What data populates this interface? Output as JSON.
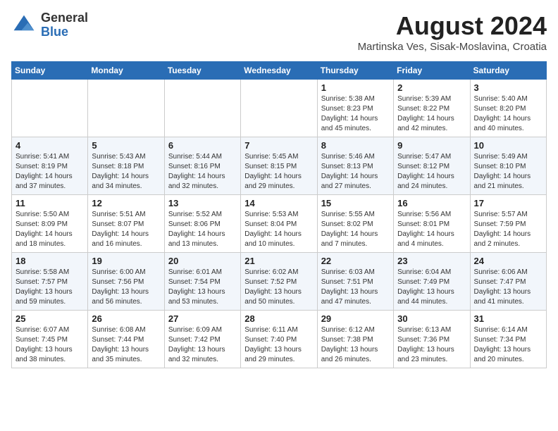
{
  "header": {
    "logo_line1": "General",
    "logo_line2": "Blue",
    "month_year": "August 2024",
    "location": "Martinska Ves, Sisak-Moslavina, Croatia"
  },
  "days_of_week": [
    "Sunday",
    "Monday",
    "Tuesday",
    "Wednesday",
    "Thursday",
    "Friday",
    "Saturday"
  ],
  "weeks": [
    [
      {
        "day": "",
        "info": ""
      },
      {
        "day": "",
        "info": ""
      },
      {
        "day": "",
        "info": ""
      },
      {
        "day": "",
        "info": ""
      },
      {
        "day": "1",
        "info": "Sunrise: 5:38 AM\nSunset: 8:23 PM\nDaylight: 14 hours\nand 45 minutes."
      },
      {
        "day": "2",
        "info": "Sunrise: 5:39 AM\nSunset: 8:22 PM\nDaylight: 14 hours\nand 42 minutes."
      },
      {
        "day": "3",
        "info": "Sunrise: 5:40 AM\nSunset: 8:20 PM\nDaylight: 14 hours\nand 40 minutes."
      }
    ],
    [
      {
        "day": "4",
        "info": "Sunrise: 5:41 AM\nSunset: 8:19 PM\nDaylight: 14 hours\nand 37 minutes."
      },
      {
        "day": "5",
        "info": "Sunrise: 5:43 AM\nSunset: 8:18 PM\nDaylight: 14 hours\nand 34 minutes."
      },
      {
        "day": "6",
        "info": "Sunrise: 5:44 AM\nSunset: 8:16 PM\nDaylight: 14 hours\nand 32 minutes."
      },
      {
        "day": "7",
        "info": "Sunrise: 5:45 AM\nSunset: 8:15 PM\nDaylight: 14 hours\nand 29 minutes."
      },
      {
        "day": "8",
        "info": "Sunrise: 5:46 AM\nSunset: 8:13 PM\nDaylight: 14 hours\nand 27 minutes."
      },
      {
        "day": "9",
        "info": "Sunrise: 5:47 AM\nSunset: 8:12 PM\nDaylight: 14 hours\nand 24 minutes."
      },
      {
        "day": "10",
        "info": "Sunrise: 5:49 AM\nSunset: 8:10 PM\nDaylight: 14 hours\nand 21 minutes."
      }
    ],
    [
      {
        "day": "11",
        "info": "Sunrise: 5:50 AM\nSunset: 8:09 PM\nDaylight: 14 hours\nand 18 minutes."
      },
      {
        "day": "12",
        "info": "Sunrise: 5:51 AM\nSunset: 8:07 PM\nDaylight: 14 hours\nand 16 minutes."
      },
      {
        "day": "13",
        "info": "Sunrise: 5:52 AM\nSunset: 8:06 PM\nDaylight: 14 hours\nand 13 minutes."
      },
      {
        "day": "14",
        "info": "Sunrise: 5:53 AM\nSunset: 8:04 PM\nDaylight: 14 hours\nand 10 minutes."
      },
      {
        "day": "15",
        "info": "Sunrise: 5:55 AM\nSunset: 8:02 PM\nDaylight: 14 hours\nand 7 minutes."
      },
      {
        "day": "16",
        "info": "Sunrise: 5:56 AM\nSunset: 8:01 PM\nDaylight: 14 hours\nand 4 minutes."
      },
      {
        "day": "17",
        "info": "Sunrise: 5:57 AM\nSunset: 7:59 PM\nDaylight: 14 hours\nand 2 minutes."
      }
    ],
    [
      {
        "day": "18",
        "info": "Sunrise: 5:58 AM\nSunset: 7:57 PM\nDaylight: 13 hours\nand 59 minutes."
      },
      {
        "day": "19",
        "info": "Sunrise: 6:00 AM\nSunset: 7:56 PM\nDaylight: 13 hours\nand 56 minutes."
      },
      {
        "day": "20",
        "info": "Sunrise: 6:01 AM\nSunset: 7:54 PM\nDaylight: 13 hours\nand 53 minutes."
      },
      {
        "day": "21",
        "info": "Sunrise: 6:02 AM\nSunset: 7:52 PM\nDaylight: 13 hours\nand 50 minutes."
      },
      {
        "day": "22",
        "info": "Sunrise: 6:03 AM\nSunset: 7:51 PM\nDaylight: 13 hours\nand 47 minutes."
      },
      {
        "day": "23",
        "info": "Sunrise: 6:04 AM\nSunset: 7:49 PM\nDaylight: 13 hours\nand 44 minutes."
      },
      {
        "day": "24",
        "info": "Sunrise: 6:06 AM\nSunset: 7:47 PM\nDaylight: 13 hours\nand 41 minutes."
      }
    ],
    [
      {
        "day": "25",
        "info": "Sunrise: 6:07 AM\nSunset: 7:45 PM\nDaylight: 13 hours\nand 38 minutes."
      },
      {
        "day": "26",
        "info": "Sunrise: 6:08 AM\nSunset: 7:44 PM\nDaylight: 13 hours\nand 35 minutes."
      },
      {
        "day": "27",
        "info": "Sunrise: 6:09 AM\nSunset: 7:42 PM\nDaylight: 13 hours\nand 32 minutes."
      },
      {
        "day": "28",
        "info": "Sunrise: 6:11 AM\nSunset: 7:40 PM\nDaylight: 13 hours\nand 29 minutes."
      },
      {
        "day": "29",
        "info": "Sunrise: 6:12 AM\nSunset: 7:38 PM\nDaylight: 13 hours\nand 26 minutes."
      },
      {
        "day": "30",
        "info": "Sunrise: 6:13 AM\nSunset: 7:36 PM\nDaylight: 13 hours\nand 23 minutes."
      },
      {
        "day": "31",
        "info": "Sunrise: 6:14 AM\nSunset: 7:34 PM\nDaylight: 13 hours\nand 20 minutes."
      }
    ]
  ]
}
